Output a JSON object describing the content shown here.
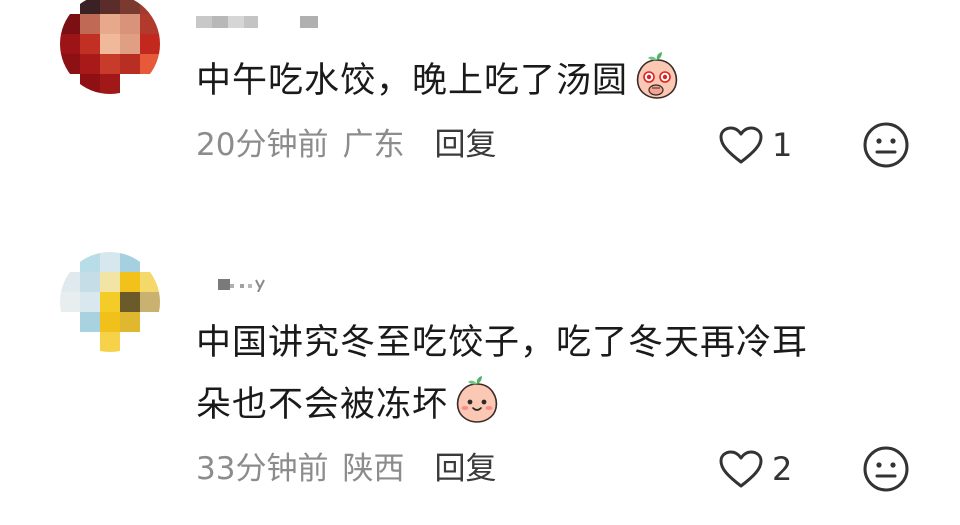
{
  "comments": [
    {
      "username": "",
      "text_lines": [
        "中午吃水饺，晚上吃了汤圆"
      ],
      "emoji": "peach-covering-mouth-emoji",
      "time": "20分钟前",
      "region": "广东",
      "reply_label": "回复",
      "likes": "1"
    },
    {
      "username": "",
      "text_lines": [
        "中国讲究冬至吃饺子，吃了冬天再冷耳",
        "朵也不会被冻坏"
      ],
      "emoji": "peach-smile-emoji",
      "time": "33分钟前",
      "region": "陕西",
      "reply_label": "回复",
      "likes": "2"
    }
  ],
  "icons": {
    "like": "heart-outline-icon",
    "dislike": "meh-face-icon"
  },
  "colors": {
    "text": "#1a1a1a",
    "meta": "#8c8c8c",
    "reply": "#3a3a3a",
    "icon": "#333333",
    "peach": "#fbc8b4",
    "peach_leaf": "#4fb36a"
  }
}
